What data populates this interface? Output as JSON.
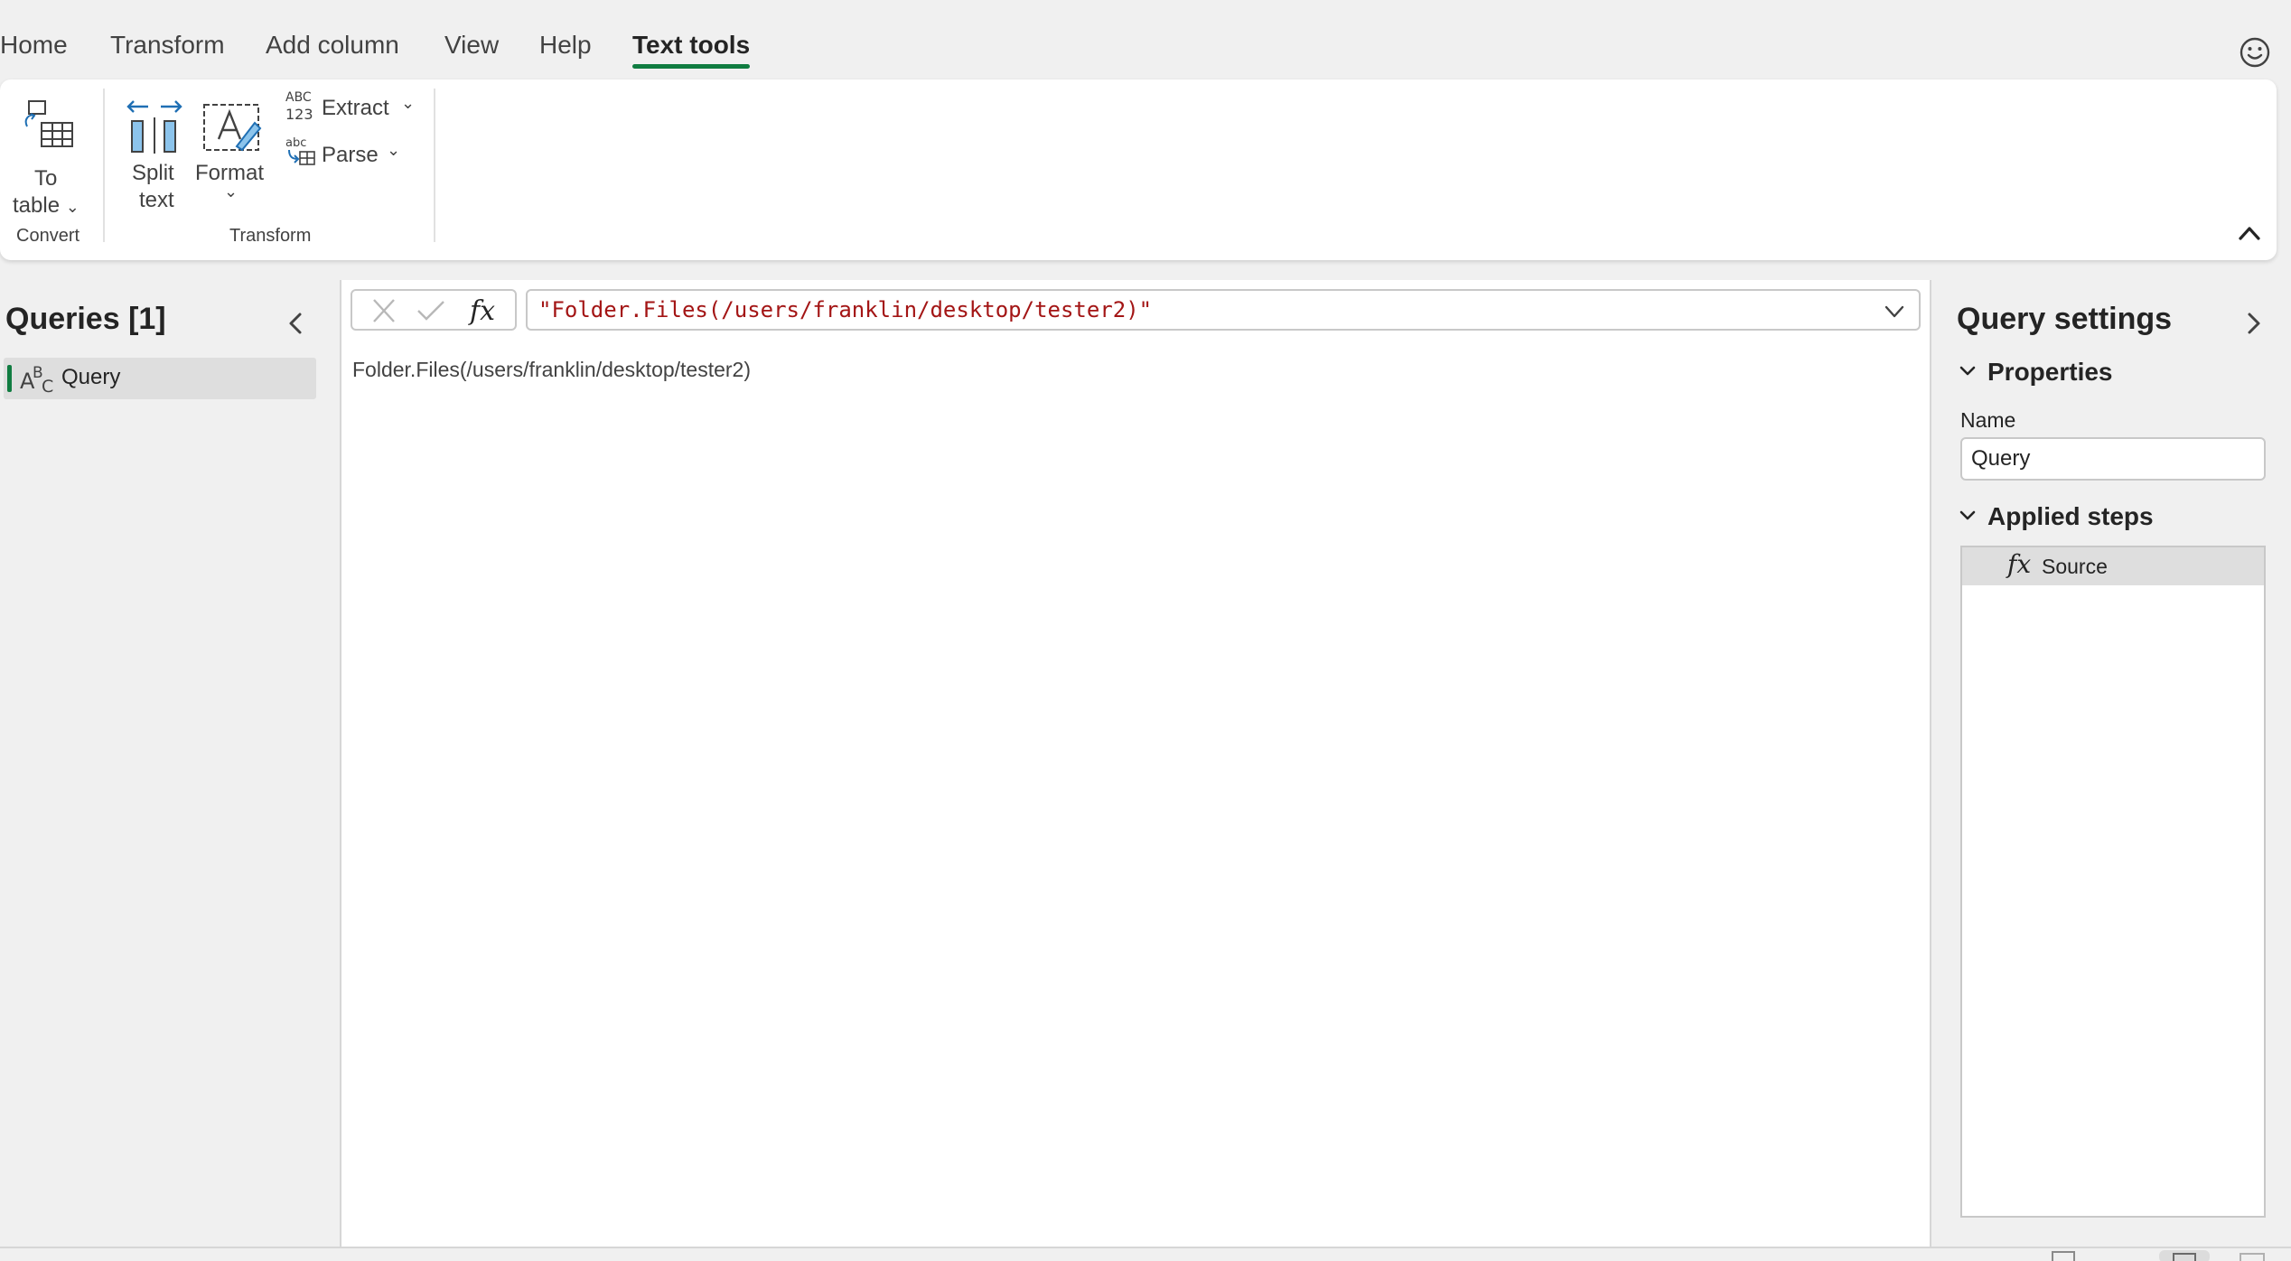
{
  "menu": {
    "tabs": [
      "Home",
      "Transform",
      "Add column",
      "View",
      "Help",
      "Text tools"
    ],
    "active_tab": "Text tools",
    "feedback_icon": "smiley-icon"
  },
  "ribbon": {
    "to_table": {
      "line1": "To",
      "line2": "table"
    },
    "split_text": {
      "line1": "Split",
      "line2": "text"
    },
    "format": {
      "label": "Format"
    },
    "extract": {
      "label": "Extract"
    },
    "parse": {
      "label": "Parse"
    },
    "groups": {
      "convert": "Convert",
      "transform": "Transform"
    }
  },
  "queries": {
    "title": "Queries [1]",
    "items": [
      {
        "label": "Query",
        "icon": "abc-text-icon"
      }
    ]
  },
  "formula": {
    "text": "\"Folder.Files(/users/franklin/desktop/tester2)\""
  },
  "result": {
    "value": "Folder.Files(/users/franklin/desktop/tester2)"
  },
  "settings": {
    "title": "Query settings",
    "properties_heading": "Properties",
    "name_label": "Name",
    "name_value": "Query",
    "applied_steps_heading": "Applied steps",
    "steps": [
      {
        "label": "Source",
        "icon": "fx-icon"
      }
    ]
  },
  "colors": {
    "accent": "#107c41",
    "formula_text": "#a31515",
    "icon_blue": "#1f6fb4"
  }
}
